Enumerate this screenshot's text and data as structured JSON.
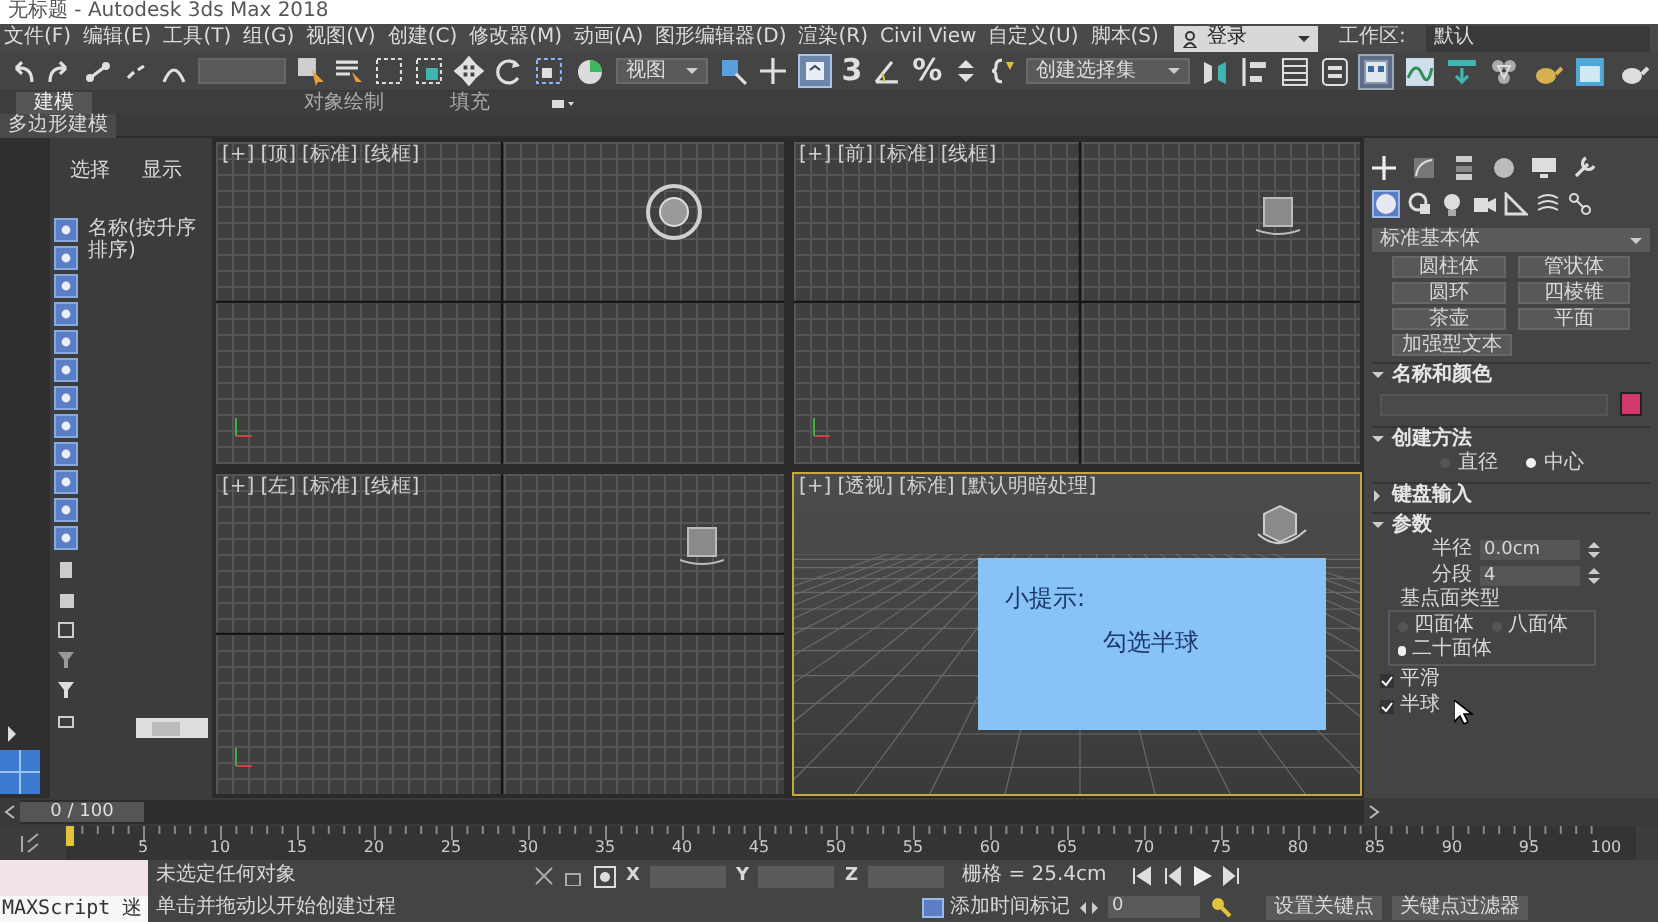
{
  "window": {
    "title": "无标题 - Autodesk 3ds Max 2018"
  },
  "menu": [
    "文件(F)",
    "编辑(E)",
    "工具(T)",
    "组(G)",
    "视图(V)",
    "创建(C)",
    "修改器(M)",
    "动画(A)",
    "图形编辑器(D)",
    "渲染(R)",
    "Civil View",
    "自定义(U)",
    "脚本(S)"
  ],
  "account": {
    "label": "登录"
  },
  "workspace": {
    "label": "工作区:",
    "value": "默认"
  },
  "toolbar": {
    "view_dropdown": "视图",
    "snap_buttons": [
      "3",
      "%"
    ],
    "selection_set": "创建选择集"
  },
  "ribbon": {
    "tabs": [
      {
        "label": "建模",
        "selected": true
      },
      {
        "label": "对象绘制",
        "selected": false
      },
      {
        "label": "填充",
        "selected": false
      }
    ],
    "panel_label": "多边形建模"
  },
  "scene_explorer": {
    "tabs": [
      "选择",
      "显示"
    ],
    "column": "名称(按升序排序)"
  },
  "viewports": [
    {
      "kind": "top",
      "active": false,
      "labels": [
        "[+]",
        "[顶]",
        "[标准]",
        "[线框]"
      ]
    },
    {
      "kind": "front",
      "active": false,
      "labels": [
        "[+]",
        "[前]",
        "[标准]",
        "[线框]"
      ]
    },
    {
      "kind": "left",
      "active": false,
      "labels": [
        "[+]",
        "[左]",
        "[标准]",
        "[线框]"
      ]
    },
    {
      "kind": "perspective",
      "active": true,
      "labels": [
        "[+]",
        "[透视]",
        "[标准]",
        "[默认明暗处理]"
      ]
    }
  ],
  "tip": {
    "title": "小提示:",
    "text": "勾选半球"
  },
  "command_panel": {
    "category": "标准基本体",
    "object_types": [
      "圆柱体",
      "管状体",
      "圆环",
      "四棱锥",
      "茶壶",
      "平面",
      "加强型文本"
    ],
    "rollouts": [
      {
        "kind": "name_color",
        "title": "名称和颜色",
        "expanded": true,
        "color": "#d2386e"
      },
      {
        "kind": "creation",
        "title": "创建方法",
        "expanded": true,
        "options": [
          {
            "label": "直径",
            "selected": false
          },
          {
            "label": "中心",
            "selected": true
          }
        ]
      },
      {
        "kind": "keyboard",
        "title": "键盘输入",
        "expanded": false
      },
      {
        "kind": "params",
        "title": "参数",
        "expanded": true,
        "fields": [
          {
            "label": "半径",
            "value": "0.0cm"
          },
          {
            "label": "分段",
            "value": "4"
          }
        ],
        "group_title": "基点面类型",
        "types": [
          {
            "label": "四面体",
            "selected": false
          },
          {
            "label": "八面体",
            "selected": false
          },
          {
            "label": "二十面体",
            "selected": true
          }
        ],
        "checks": [
          {
            "label": "平滑",
            "checked": true
          },
          {
            "label": "半球",
            "checked": true
          }
        ]
      }
    ]
  },
  "timeline": {
    "position": "0 / 100",
    "level": 0,
    "ticks": [
      "5",
      "10",
      "15",
      "20",
      "25",
      "30",
      "35",
      "40",
      "45",
      "50",
      "55",
      "60",
      "65",
      "70",
      "75",
      "80",
      "85",
      "90",
      "95",
      "100"
    ]
  },
  "status": {
    "maxscript": "MAXScript 迷",
    "selection": "未选定任何对象",
    "prompt": "单击并拖动以开始创建过程",
    "axes": [
      "X",
      "Y",
      "Z"
    ],
    "grid": "栅格 = 25.4cm",
    "time_tag": "添加时间标记",
    "frame": "0",
    "set_key": "设置关键点",
    "key_filter": "关键点过滤器"
  }
}
